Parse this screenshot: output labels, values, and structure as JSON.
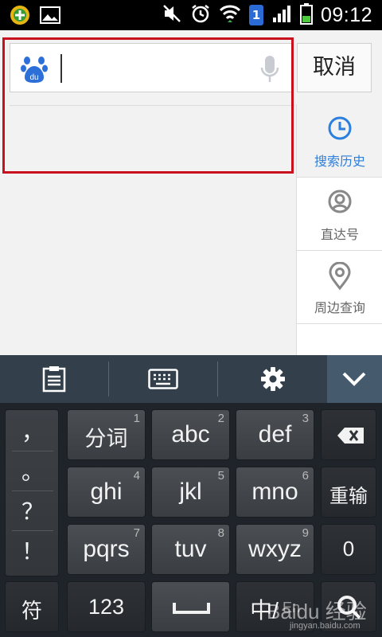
{
  "status_bar": {
    "time": "09:12",
    "notification_badge": "1",
    "icons": [
      "app-notification-icon",
      "image-icon",
      "mute-icon",
      "alarm-icon",
      "wifi-icon",
      "sim-badge-icon",
      "signal-icon",
      "battery-icon"
    ]
  },
  "search": {
    "placeholder": "",
    "value": "",
    "logo_text": "du",
    "cancel_label": "取消"
  },
  "side_tabs": [
    {
      "label": "搜索历史",
      "icon": "clock-icon",
      "active": true
    },
    {
      "label": "直达号",
      "icon": "direct-icon",
      "active": false
    },
    {
      "label": "周边查询",
      "icon": "location-pin-icon",
      "active": false
    }
  ],
  "keyboard": {
    "toolbar": [
      "clipboard-icon",
      "keyboard-icon",
      "settings-icon",
      "collapse-icon"
    ],
    "punctuation": [
      "，",
      "。",
      "？",
      "！"
    ],
    "row1": [
      {
        "label": "分词",
        "num": "1"
      },
      {
        "label": "abc",
        "num": "2"
      },
      {
        "label": "def",
        "num": "3"
      }
    ],
    "row2": [
      {
        "label": "ghi",
        "num": "4"
      },
      {
        "label": "jkl",
        "num": "5"
      },
      {
        "label": "mno",
        "num": "6"
      }
    ],
    "row3": [
      {
        "label": "pqrs",
        "num": "7"
      },
      {
        "label": "tuv",
        "num": "8"
      },
      {
        "label": "wxyz",
        "num": "9"
      }
    ],
    "backspace_icon": "backspace-icon",
    "retype_label": "重输",
    "zero_label": "0",
    "symbol_label": "符",
    "numbers_label": "123",
    "space_icon": "space-icon",
    "lang_label": "中/",
    "lang_alt": "En",
    "search_icon": "search-icon"
  },
  "watermark": {
    "text": "Baidu 经验",
    "url": "jingyan.baidu.com"
  },
  "colors": {
    "accent": "#2c7fdc",
    "highlight_frame": "#c8101e",
    "keyboard_bg": "#1e242a",
    "toolbar_bg": "#33404c"
  }
}
